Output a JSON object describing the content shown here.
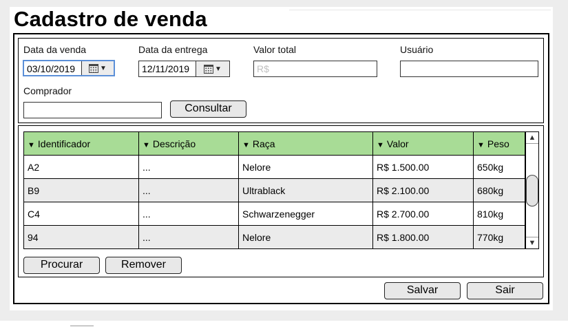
{
  "title": "Cadastro de venda",
  "filters": {
    "data_venda": {
      "label": "Data da venda",
      "value": "03/10/2019"
    },
    "data_entrega": {
      "label": "Data da entrega",
      "value": "12/11/2019"
    },
    "valor_total": {
      "label": "Valor total",
      "placeholder": "R$"
    },
    "usuario": {
      "label": "Usuário",
      "value": ""
    },
    "comprador": {
      "label": "Comprador",
      "value": ""
    },
    "consultar_label": "Consultar"
  },
  "table": {
    "columns": [
      "Identificador",
      "Descrição",
      "Raça",
      "Valor",
      "Peso"
    ],
    "sort_arrow": "▼",
    "rows": [
      {
        "id": "A2",
        "descricao": "...",
        "raca": "Nelore",
        "valor": "R$ 1.500.00",
        "peso": "650kg"
      },
      {
        "id": "B9",
        "descricao": "...",
        "raca": "Ultrablack",
        "valor": "R$ 2.100.00",
        "peso": "680kg"
      },
      {
        "id": "C4",
        "descricao": "...",
        "raca": "Schwarzenegger",
        "valor": "R$ 2.700.00",
        "peso": "810kg"
      },
      {
        "id": "94",
        "descricao": "...",
        "raca": "Nelore",
        "valor": "R$ 1.800.00",
        "peso": "770kg"
      }
    ]
  },
  "actions": {
    "procurar": "Procurar",
    "remover": "Remover",
    "salvar": "Salvar",
    "sair": "Sair"
  },
  "icons": {
    "calendar": "calendar-icon",
    "dropdown": "▼",
    "scroll_up": "▲",
    "scroll_down": "▼"
  },
  "colors": {
    "header_green": "#a8dc96",
    "focus_blue": "#5b8fd8",
    "alt_row": "#ebebeb"
  }
}
